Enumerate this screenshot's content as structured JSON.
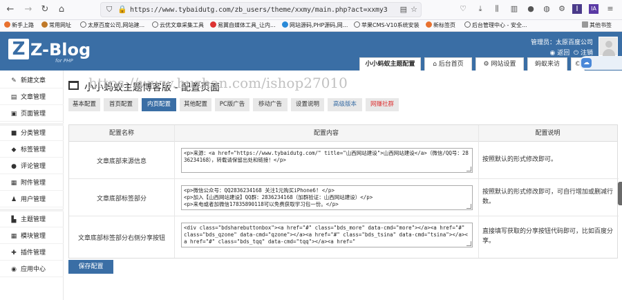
{
  "browser": {
    "url": "https://www.tybaidutg.com/zb_users/theme/xxmy/main.php?act=xxmy3",
    "bookmarks": [
      "新手上路",
      "常用网址",
      "太原百度公司,网站建...",
      "云优文章采集工具",
      "易翼自媒体工具_让内...",
      "网站源码,PHP源码,网...",
      "苹果CMS-V10系统安装",
      "新标签页",
      "后台管理中心 - 安全..."
    ],
    "other_bookmarks": "其他书签"
  },
  "header": {
    "logo_text": "Z-Blog",
    "logo_sub": "for PHP",
    "admin_label": "管理员：太原百度公司",
    "return_link": "返回",
    "logout_link": "注销",
    "tabs": [
      "小小蚂蚁主题配置",
      "后台首页",
      "网站设置",
      "蚂蚁来访"
    ]
  },
  "sidebar": {
    "items": [
      {
        "label": "新建文章",
        "icon": "pencil-icon"
      },
      {
        "label": "文章管理",
        "icon": "document-icon"
      },
      {
        "label": "页面管理",
        "icon": "page-icon"
      },
      {
        "label": "分类管理",
        "icon": "folder-icon"
      },
      {
        "label": "标签管理",
        "icon": "tag-icon"
      },
      {
        "label": "评论管理",
        "icon": "comment-icon"
      },
      {
        "label": "附件管理",
        "icon": "attachment-icon"
      },
      {
        "label": "用户管理",
        "icon": "users-icon"
      },
      {
        "label": "主题管理",
        "icon": "theme-icon"
      },
      {
        "label": "模块管理",
        "icon": "module-icon"
      },
      {
        "label": "插件管理",
        "icon": "plugin-icon"
      },
      {
        "label": "应用中心",
        "icon": "app-center-icon"
      }
    ]
  },
  "main": {
    "title": "小小蚂蚁主题博客版 - 配置页面",
    "watermark": "https://www.huzhan.com/ishop27010",
    "subtabs": [
      "基本配置",
      "首页配置",
      "内页配置",
      "其他配置",
      "PC版广告",
      "移动广告",
      "设置说明",
      "高级版本",
      "网赚社群"
    ],
    "table": {
      "headers": [
        "配置名称",
        "配置内容",
        "配置说明"
      ],
      "rows": [
        {
          "name": "文章底部来源信息",
          "content": "<p>来源：<a href=\"https://www.tybaidutg.com/\" title=\"山西网站建设\">山西网站建设</a>（微信/QQ号：2836234168），转载请保留出处和链接！</p>",
          "desc": "按照默认的形式修改即可。"
        },
        {
          "name": "文章底部标签部分",
          "content": "<p>微信公众号：QQ2836234168 关注1元购买iPhone6! </p>\n<p>加入【山西网站建设】QQ群：2836234168（加群验证：山西网站建设）</p>\n<p>来电或者加微信17835890118可以免费获取学习包一份。</p>",
          "desc": "按照默认的形式修改即可，可自行增加或删减行数。"
        },
        {
          "name": "文章底部标签部分右侧分享按钮",
          "content": "<div class=\"bdsharebuttonbox\"><a href=\"#\" class=\"bds_more\" data-cmd=\"more\"></a><a href=\"#\" class=\"bds_qzone\" data-cmd=\"qzone\"></a><a href=\"#\" class=\"bds_tsina\" data-cmd=\"tsina\"></a><a href=\"#\" class=\"bds_tqq\" data-cmd=\"tqq\"></a><a href=\"",
          "desc": "直接填写获取的分享按钮代码即可，比如百度分享。"
        }
      ]
    },
    "save_label": "保存配置"
  },
  "colors": {
    "brand": "#3a6ea5",
    "active_tab": "#3a6ea5",
    "red_link": "#d33"
  }
}
